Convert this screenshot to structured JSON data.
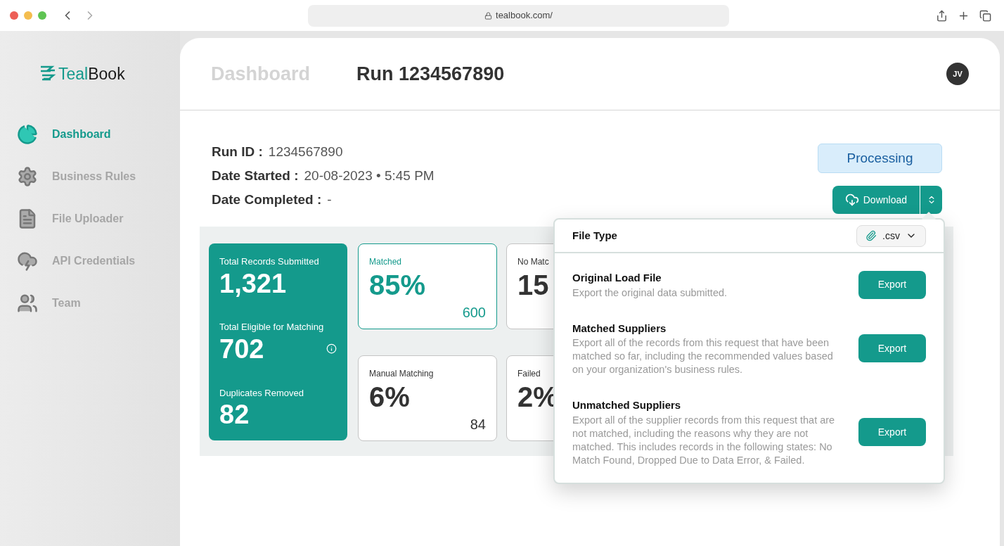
{
  "browser": {
    "url": "tealbook.com/"
  },
  "sidebar": {
    "logo": {
      "text_parts": [
        "Teal",
        "Book"
      ]
    },
    "items": [
      {
        "label": "Dashboard",
        "selected": true,
        "kind": "dashboard"
      },
      {
        "label": "Business Rules",
        "selected": false,
        "kind": "rules"
      },
      {
        "label": "File Uploader",
        "selected": false,
        "kind": "file"
      },
      {
        "label": "API Credentials",
        "selected": false,
        "kind": "api"
      },
      {
        "label": "Team",
        "selected": false,
        "kind": "team"
      }
    ]
  },
  "header": {
    "breadcrumb": "Dashboard",
    "title": "Run 1234567890",
    "avatar": "JV"
  },
  "run_info": [
    {
      "label": "Run ID :",
      "value": "1234567890"
    },
    {
      "label": "Date Started :",
      "value": "20-08-2023 • 5:45 PM"
    },
    {
      "label": "Date Completed :",
      "value": "-"
    }
  ],
  "status": "Processing",
  "download": {
    "label": "Download"
  },
  "summary": [
    {
      "label": "Total Records Submitted",
      "value": "1,321",
      "info": false
    },
    {
      "label": "Total Eligible for Matching",
      "value": "702",
      "info": true
    },
    {
      "label": "Duplicates Removed",
      "value": "82",
      "info": false
    }
  ],
  "cards": [
    {
      "label": "Matched",
      "value": "85%",
      "count": "600",
      "highlighted": true
    },
    {
      "label": "No Matc",
      "value": "15",
      "highlighted": false
    },
    {
      "label": "Manual Matching",
      "value": "6%",
      "count": "84",
      "highlighted": false
    },
    {
      "label": "Failed",
      "value": "2%",
      "highlighted": false
    }
  ],
  "export_menu": {
    "title": "File Type",
    "file_type": ".csv",
    "options": [
      {
        "title": "Original Load File",
        "description": "Export the original data submitted.",
        "button": "Export"
      },
      {
        "title": "Matched Suppliers",
        "description": "Export all of the records from this request that have been matched so far, including the recommended values based on your organization's business rules.",
        "button": "Export"
      },
      {
        "title": "Unmatched Suppliers",
        "description": "Export all of the supplier records from this request that are not matched, including the reasons why they are not matched. This includes records in the following states: No Match Found, Dropped Due to Data Error, & Failed.",
        "button": "Export"
      }
    ]
  }
}
